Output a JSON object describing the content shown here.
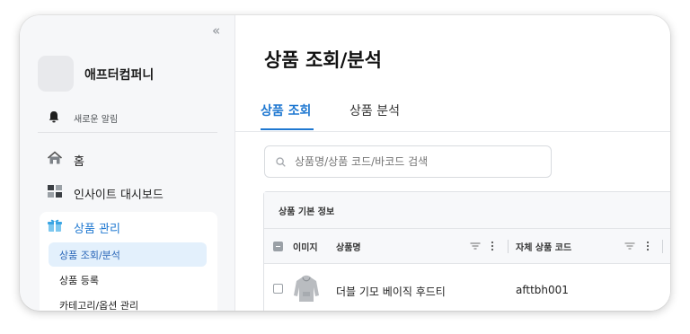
{
  "sidebar": {
    "collapse": "«",
    "company_name": "애프터컴퍼니",
    "notice_label": "새로운 알림",
    "nav": {
      "home": "홈",
      "dashboard": "인사이트 대시보드",
      "products": "상품 관리"
    },
    "sub_items": [
      "상품 조회/분석",
      "상품 등록",
      "카테고리/옵션 관리"
    ]
  },
  "main": {
    "title": "상품 조회/분석",
    "tabs": [
      "상품 조회",
      "상품 분석"
    ],
    "search_placeholder": "상품명/상품 코드/바코드 검색",
    "grid": {
      "group_header": "상품 기본 정보",
      "columns": [
        "이미지",
        "상품명",
        "자체 상품 코드"
      ],
      "rows": [
        {
          "name": "더블 기모 베이직 후드티",
          "code": "afttbh001"
        }
      ]
    }
  },
  "colors": {
    "accent": "#1f78d1",
    "active_bg": "#e3f0fc"
  }
}
